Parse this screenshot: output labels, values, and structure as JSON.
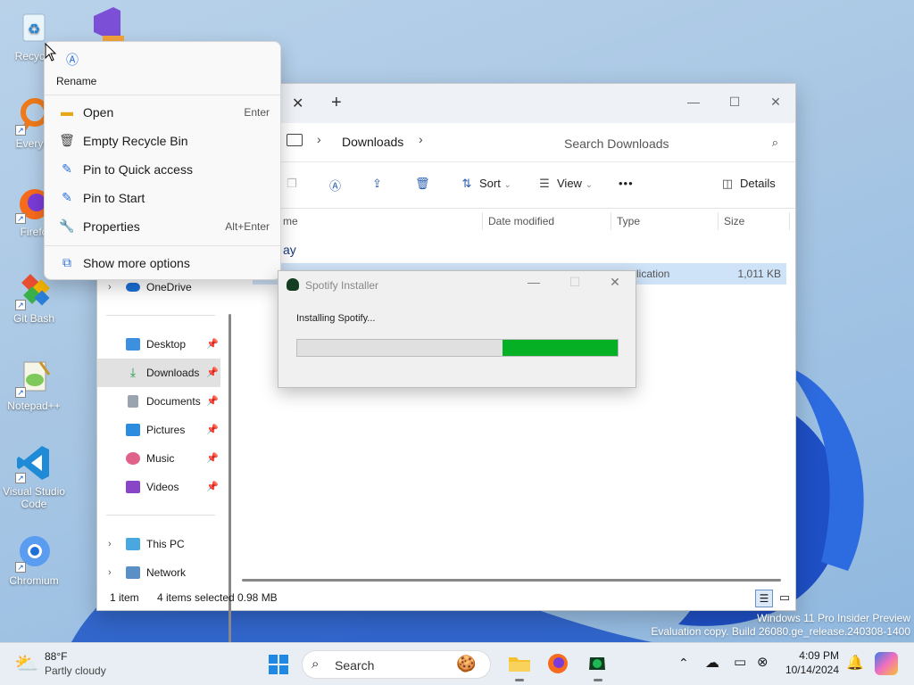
{
  "desktop": {
    "icons": [
      {
        "label": "Recycle",
        "icon": "recycle-bin-icon"
      },
      {
        "label": "",
        "icon": "visual-studio-icon"
      },
      {
        "label": "Everyth",
        "icon": "everything-search-icon"
      },
      {
        "label": "Firefo",
        "icon": "firefox-icon"
      },
      {
        "label": "Git Bash",
        "icon": "git-bash-icon"
      },
      {
        "label": "Notepad++",
        "icon": "notepad-plus-plus-icon"
      },
      {
        "label": "Visual Studio Code",
        "icon": "vscode-icon"
      },
      {
        "label": "Chromium",
        "icon": "chromium-icon"
      }
    ]
  },
  "context_menu": {
    "rename_label": "Rename",
    "items": [
      {
        "label": "Open",
        "shortcut": "Enter",
        "icon": "folder-icon"
      },
      {
        "label": "Empty Recycle Bin",
        "shortcut": "",
        "icon": "trash-icon"
      },
      {
        "label": "Pin to Quick access",
        "shortcut": "",
        "icon": "pin-icon"
      },
      {
        "label": "Pin to Start",
        "shortcut": "",
        "icon": "pin-icon"
      },
      {
        "label": "Properties",
        "shortcut": "Alt+Enter",
        "icon": "wrench-icon"
      }
    ],
    "more_options": "Show more options"
  },
  "explorer": {
    "address": "Downloads",
    "search_placeholder": "Search Downloads",
    "toolbar": {
      "sort": "Sort",
      "view": "View",
      "more": "•••",
      "details": "Details"
    },
    "columns": [
      "me",
      "Date modified",
      "Type",
      "Size"
    ],
    "group_label": "ay",
    "file_row": {
      "type": "lication",
      "size": "1,011 KB"
    },
    "nav": {
      "onedrive": "OneDrive",
      "desktop": "Desktop",
      "downloads": "Downloads",
      "documents": "Documents",
      "pictures": "Pictures",
      "music": "Music",
      "videos": "Videos",
      "this_pc": "This PC",
      "network": "Network"
    },
    "status": {
      "items": "1 item",
      "selected": "4 items selected",
      "size": "0.98 MB"
    }
  },
  "installer": {
    "title": "Spotify Installer",
    "message": "Installing Spotify...",
    "progress": 0.36
  },
  "watermark": {
    "line1": "Windows 11 Pro Insider Preview",
    "line2": "Evaluation copy. Build 26080.ge_release.240308-1400"
  },
  "taskbar": {
    "weather_temp": "88°F",
    "weather_desc": "Partly cloudy",
    "search_label": "Search",
    "time": "4:09 PM",
    "date": "10/14/2024"
  },
  "colors": {
    "accent": "#2a6fd6",
    "progress_green": "#06b025",
    "selection": "#cfe3f8"
  }
}
